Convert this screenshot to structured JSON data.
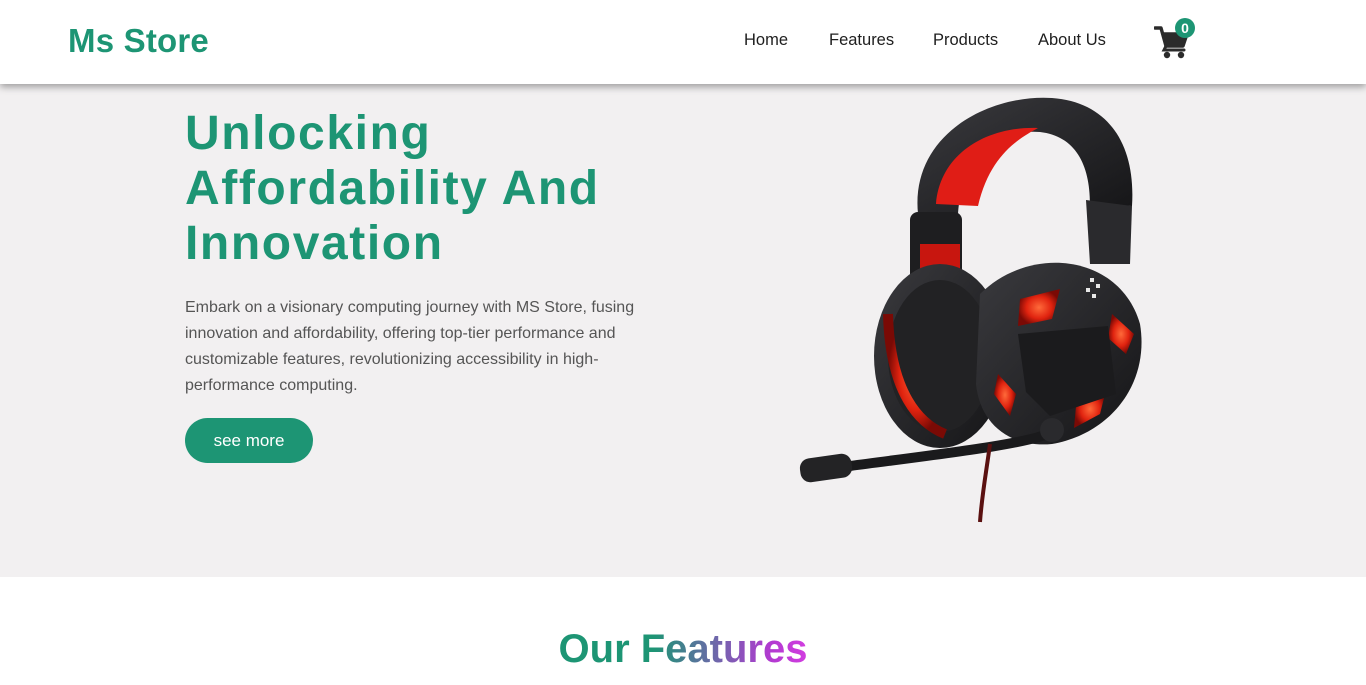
{
  "header": {
    "logo": "Ms Store",
    "nav": [
      {
        "label": "Home"
      },
      {
        "label": "Features"
      },
      {
        "label": "Products"
      },
      {
        "label": "About Us"
      }
    ],
    "cart": {
      "icon": "shopping-cart-icon",
      "count": "0"
    }
  },
  "hero": {
    "title_lines": [
      "Unlocking",
      "Affordability And",
      "Innovation"
    ],
    "description": "Embark on a visionary computing journey with MS Store, fusing innovation and affordability, offering top-tier performance and customizable features, revolutionizing accessibility in high-performance computing.",
    "button_label": "see more",
    "image": "gaming-headset-image"
  },
  "features": {
    "heading": "Our Features"
  },
  "colors": {
    "brand": "#1d9574",
    "hero_bg": "#f2f0f1",
    "heading_gradient_end": "#d23de0",
    "nav_text": "#1e1e1e",
    "body_text": "#555555"
  }
}
